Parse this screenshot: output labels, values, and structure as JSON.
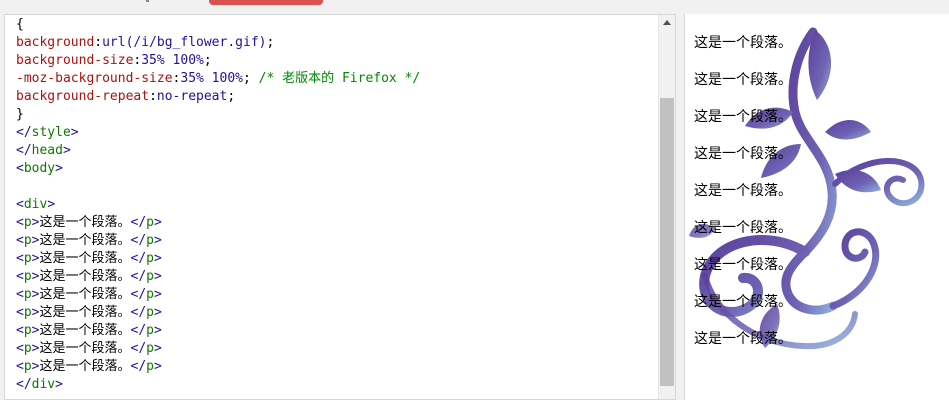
{
  "editor": {
    "lines": [
      [
        {
          "t": "{",
          "c": "plain"
        }
      ],
      [
        {
          "t": "background",
          "c": "prop"
        },
        {
          "t": ":",
          "c": "plain"
        },
        {
          "t": "url(/i/bg_flower.gif)",
          "c": "val"
        },
        {
          "t": ";",
          "c": "plain"
        }
      ],
      [
        {
          "t": "background-size",
          "c": "prop"
        },
        {
          "t": ":",
          "c": "plain"
        },
        {
          "t": "35% 100%",
          "c": "val"
        },
        {
          "t": ";",
          "c": "plain"
        }
      ],
      [
        {
          "t": "-moz-background-size",
          "c": "prop"
        },
        {
          "t": ":",
          "c": "plain"
        },
        {
          "t": "35% 100%",
          "c": "val"
        },
        {
          "t": "; ",
          "c": "plain"
        },
        {
          "t": "/* 老版本的 Firefox */",
          "c": "comment"
        }
      ],
      [
        {
          "t": "background-repeat",
          "c": "prop"
        },
        {
          "t": ":",
          "c": "plain"
        },
        {
          "t": "no-repeat",
          "c": "val"
        },
        {
          "t": ";",
          "c": "plain"
        }
      ],
      [
        {
          "t": "}",
          "c": "plain"
        }
      ],
      [
        {
          "t": "</",
          "c": "val"
        },
        {
          "t": "style",
          "c": "tag"
        },
        {
          "t": ">",
          "c": "val"
        }
      ],
      [
        {
          "t": "</",
          "c": "val"
        },
        {
          "t": "head",
          "c": "tag"
        },
        {
          "t": ">",
          "c": "val"
        }
      ],
      [
        {
          "t": "<",
          "c": "val"
        },
        {
          "t": "body",
          "c": "tag"
        },
        {
          "t": ">",
          "c": "val"
        }
      ],
      [
        {
          "t": "",
          "c": "plain"
        }
      ],
      [
        {
          "t": "<",
          "c": "val"
        },
        {
          "t": "div",
          "c": "tag"
        },
        {
          "t": ">",
          "c": "val"
        }
      ],
      [
        {
          "t": "<",
          "c": "val"
        },
        {
          "t": "p",
          "c": "tag"
        },
        {
          "t": ">",
          "c": "val"
        },
        {
          "t": "这是一个段落。",
          "c": "plain"
        },
        {
          "t": "</",
          "c": "val"
        },
        {
          "t": "p",
          "c": "tag"
        },
        {
          "t": ">",
          "c": "val"
        }
      ],
      [
        {
          "t": "<",
          "c": "val"
        },
        {
          "t": "p",
          "c": "tag"
        },
        {
          "t": ">",
          "c": "val"
        },
        {
          "t": "这是一个段落。",
          "c": "plain"
        },
        {
          "t": "</",
          "c": "val"
        },
        {
          "t": "p",
          "c": "tag"
        },
        {
          "t": ">",
          "c": "val"
        }
      ],
      [
        {
          "t": "<",
          "c": "val"
        },
        {
          "t": "p",
          "c": "tag"
        },
        {
          "t": ">",
          "c": "val"
        },
        {
          "t": "这是一个段落。",
          "c": "plain"
        },
        {
          "t": "</",
          "c": "val"
        },
        {
          "t": "p",
          "c": "tag"
        },
        {
          "t": ">",
          "c": "val"
        }
      ],
      [
        {
          "t": "<",
          "c": "val"
        },
        {
          "t": "p",
          "c": "tag"
        },
        {
          "t": ">",
          "c": "val"
        },
        {
          "t": "这是一个段落。",
          "c": "plain"
        },
        {
          "t": "</",
          "c": "val"
        },
        {
          "t": "p",
          "c": "tag"
        },
        {
          "t": ">",
          "c": "val"
        }
      ],
      [
        {
          "t": "<",
          "c": "val"
        },
        {
          "t": "p",
          "c": "tag"
        },
        {
          "t": ">",
          "c": "val"
        },
        {
          "t": "这是一个段落。",
          "c": "plain"
        },
        {
          "t": "</",
          "c": "val"
        },
        {
          "t": "p",
          "c": "tag"
        },
        {
          "t": ">",
          "c": "val"
        }
      ],
      [
        {
          "t": "<",
          "c": "val"
        },
        {
          "t": "p",
          "c": "tag"
        },
        {
          "t": ">",
          "c": "val"
        },
        {
          "t": "这是一个段落。",
          "c": "plain"
        },
        {
          "t": "</",
          "c": "val"
        },
        {
          "t": "p",
          "c": "tag"
        },
        {
          "t": ">",
          "c": "val"
        }
      ],
      [
        {
          "t": "<",
          "c": "val"
        },
        {
          "t": "p",
          "c": "tag"
        },
        {
          "t": ">",
          "c": "val"
        },
        {
          "t": "这是一个段落。",
          "c": "plain"
        },
        {
          "t": "</",
          "c": "val"
        },
        {
          "t": "p",
          "c": "tag"
        },
        {
          "t": ">",
          "c": "val"
        }
      ],
      [
        {
          "t": "<",
          "c": "val"
        },
        {
          "t": "p",
          "c": "tag"
        },
        {
          "t": ">",
          "c": "val"
        },
        {
          "t": "这是一个段落。",
          "c": "plain"
        },
        {
          "t": "</",
          "c": "val"
        },
        {
          "t": "p",
          "c": "tag"
        },
        {
          "t": ">",
          "c": "val"
        }
      ],
      [
        {
          "t": "<",
          "c": "val"
        },
        {
          "t": "p",
          "c": "tag"
        },
        {
          "t": ">",
          "c": "val"
        },
        {
          "t": "这是一个段落。",
          "c": "plain"
        },
        {
          "t": "</",
          "c": "val"
        },
        {
          "t": "p",
          "c": "tag"
        },
        {
          "t": ">",
          "c": "val"
        }
      ],
      [
        {
          "t": "</",
          "c": "val"
        },
        {
          "t": "div",
          "c": "tag"
        },
        {
          "t": ">",
          "c": "val"
        }
      ]
    ]
  },
  "preview": {
    "paragraphs": [
      "这是一个段落。",
      "这是一个段落。",
      "这是一个段落。",
      "这是一个段落。",
      "这是一个段落。",
      "这是一个段落。",
      "这是一个段落。",
      "这是一个段落。",
      "这是一个段落。"
    ],
    "flower_colors": [
      "#6a4fa3",
      "#7b8fd0"
    ]
  },
  "colors": {
    "run_button": "#d9534f",
    "css_property": "#aa1111",
    "css_value": "#221199",
    "comment": "#008800",
    "tag_name": "#117700"
  }
}
